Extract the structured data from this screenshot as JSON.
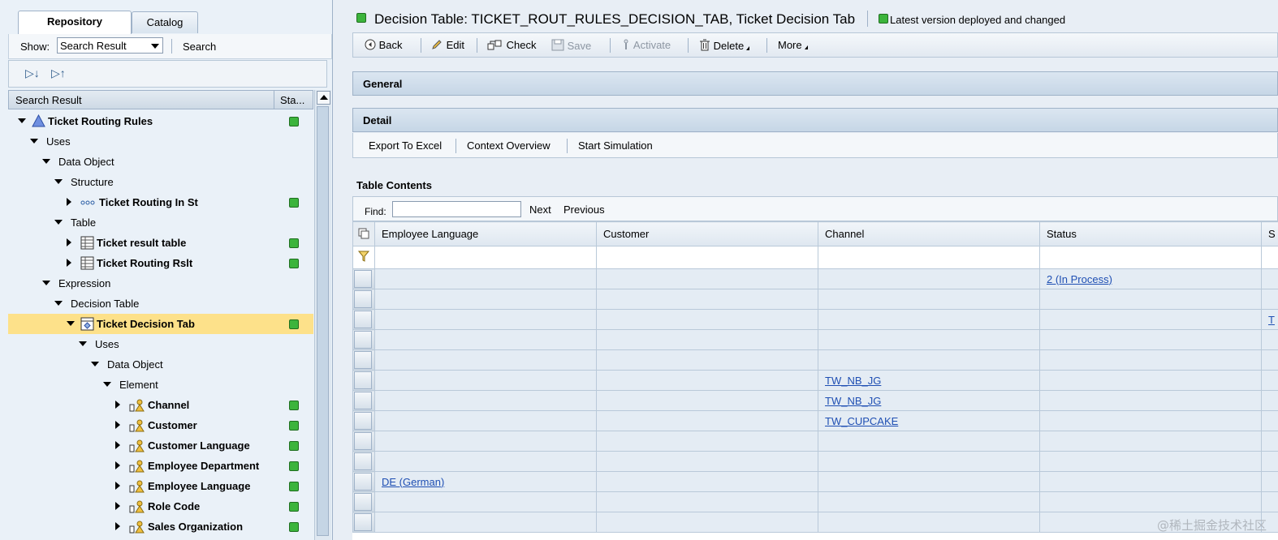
{
  "left_panel": {
    "tabs": [
      {
        "label": "Repository",
        "active": true
      },
      {
        "label": "Catalog",
        "active": false
      }
    ],
    "show_label": "Show:",
    "show_value": "Search Result",
    "search_button": "Search",
    "tree_header": {
      "col1": "Search Result",
      "col2": "Sta..."
    },
    "tree": [
      {
        "label": "Ticket Routing Rules",
        "bold": true,
        "icon": "triangle-icon",
        "status": "active"
      },
      {
        "label": "Uses"
      },
      {
        "label": "Data Object"
      },
      {
        "label": "Structure"
      },
      {
        "label": "Ticket Routing In St",
        "bold": true,
        "icon": "structure-icon",
        "status": "active"
      },
      {
        "label": "Table"
      },
      {
        "label": "Ticket result table",
        "bold": true,
        "icon": "table-icon",
        "status": "active"
      },
      {
        "label": "Ticket Routing Rslt",
        "bold": true,
        "icon": "table-icon",
        "status": "active"
      },
      {
        "label": "Expression"
      },
      {
        "label": "Decision Table"
      },
      {
        "label": "Ticket Decision Tab",
        "bold": true,
        "icon": "decision-table-icon",
        "status": "active",
        "selected": true
      },
      {
        "label": "Uses"
      },
      {
        "label": "Data Object"
      },
      {
        "label": "Element"
      },
      {
        "label": "Channel",
        "bold": true,
        "icon": "element-icon",
        "status": "active"
      },
      {
        "label": "Customer",
        "bold": true,
        "icon": "element-icon",
        "status": "active"
      },
      {
        "label": "Customer Language",
        "bold": true,
        "icon": "element-icon",
        "status": "active"
      },
      {
        "label": "Employee Department",
        "bold": true,
        "icon": "element-icon",
        "status": "active"
      },
      {
        "label": "Employee Language",
        "bold": true,
        "icon": "element-icon",
        "status": "active"
      },
      {
        "label": "Role Code",
        "bold": true,
        "icon": "element-icon",
        "status": "active"
      },
      {
        "label": "Sales Organization",
        "bold": true,
        "icon": "element-icon",
        "status": "active"
      }
    ]
  },
  "header": {
    "title": "Decision Table: TICKET_ROUT_RULES_DECISION_TAB, Ticket Decision Tab",
    "status_text": "Latest version deployed and changed"
  },
  "toolbar": {
    "back": "Back",
    "edit": "Edit",
    "check": "Check",
    "save": "Save",
    "activate": "Activate",
    "delete": "Delete",
    "more": "More"
  },
  "sections": {
    "general": "General",
    "detail": "Detail"
  },
  "detail_buttons": {
    "export": "Export To Excel",
    "context": "Context Overview",
    "simulation": "Start Simulation"
  },
  "table_contents": {
    "label": "Table Contents",
    "find_label": "Find:",
    "find_value": "",
    "next": "Next",
    "previous": "Previous",
    "columns": [
      "Employee Language",
      "Customer",
      "Channel",
      "Status",
      "S"
    ],
    "rows": [
      [
        "",
        "",
        "",
        "2 (In Process)",
        ""
      ],
      [
        "",
        "",
        "",
        "",
        ""
      ],
      [
        "",
        "",
        "",
        "",
        "T"
      ],
      [
        "",
        "",
        "",
        "",
        ""
      ],
      [
        "",
        "",
        "",
        "",
        ""
      ],
      [
        "",
        "",
        "TW_NB_JG",
        "",
        ""
      ],
      [
        "",
        "",
        "TW_NB_JG",
        "",
        ""
      ],
      [
        "",
        "",
        "TW_CUPCAKE",
        "",
        ""
      ],
      [
        "",
        "",
        "",
        "",
        ""
      ],
      [
        "",
        "",
        "",
        "",
        ""
      ],
      [
        "DE (German)",
        "",
        "",
        "",
        ""
      ],
      [
        "",
        "",
        "",
        "",
        ""
      ],
      [
        "",
        "",
        "",
        "",
        ""
      ]
    ]
  },
  "watermark": "@稀土掘金技术社区"
}
